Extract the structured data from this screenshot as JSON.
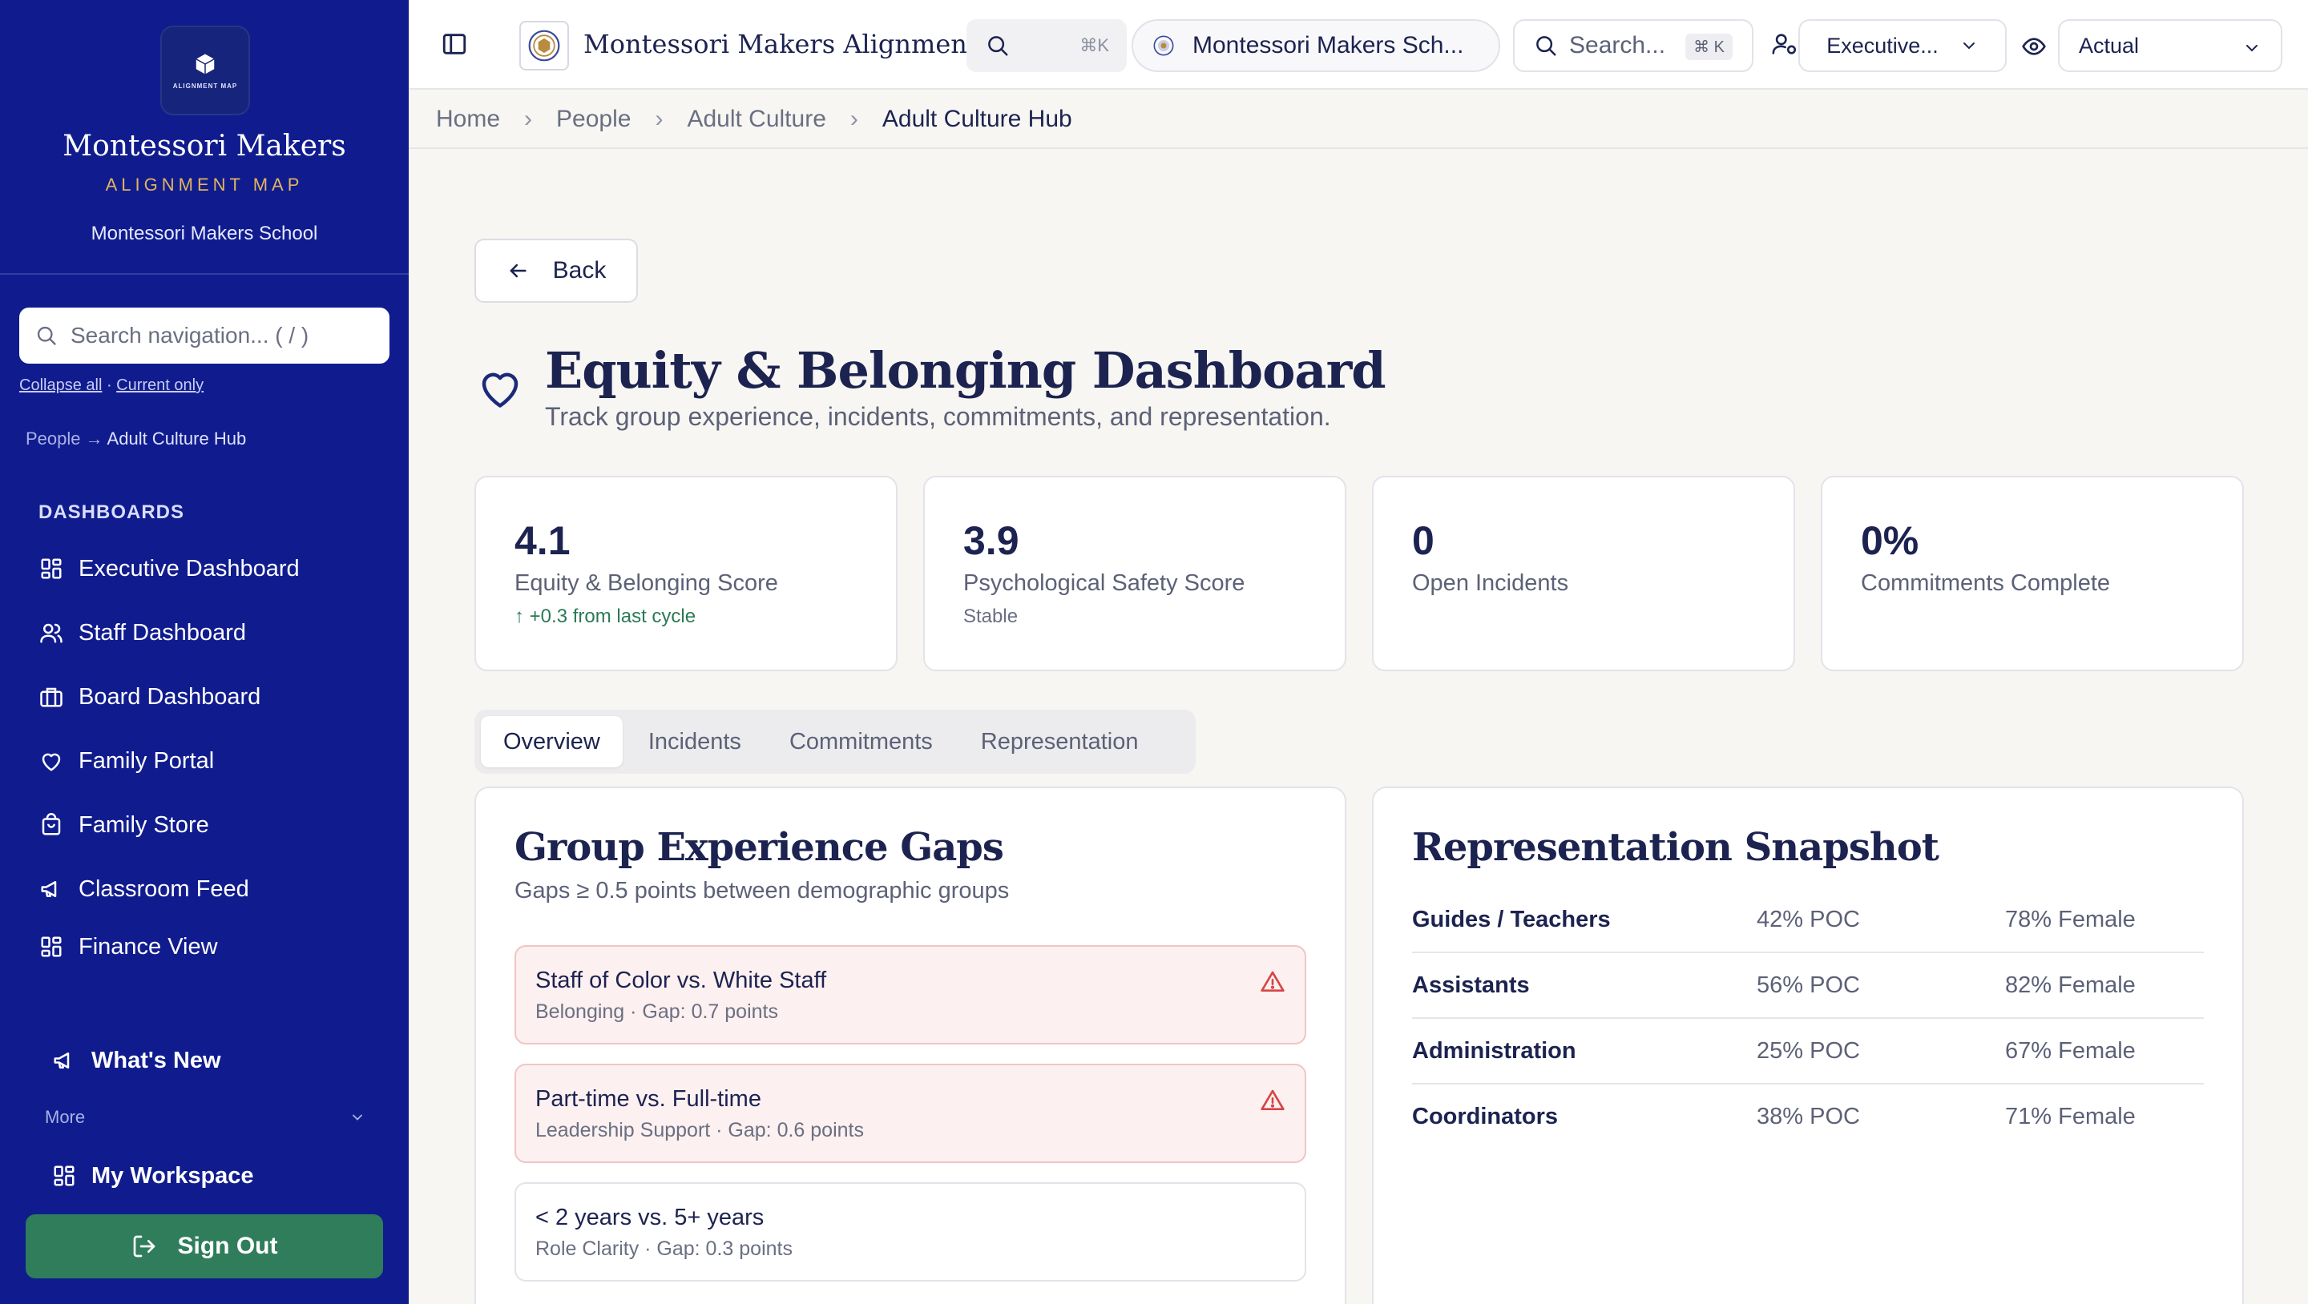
{
  "sidebar": {
    "logo_caption": "ALIGNMENT MAP",
    "brand_title": "Montessori Makers",
    "brand_subtitle": "ALIGNMENT MAP",
    "school": "Montessori Makers School",
    "search_placeholder": "Search navigation... ( / )",
    "collapse_all": "Collapse all",
    "current_only": "Current only",
    "crumb_parent": "People",
    "crumb_arrow": "→",
    "crumb_current": "Adult Culture Hub",
    "section_heading": "DASHBOARDS",
    "items": [
      {
        "label": "Executive Dashboard",
        "icon": "grid-icon"
      },
      {
        "label": "Staff Dashboard",
        "icon": "users-icon"
      },
      {
        "label": "Board Dashboard",
        "icon": "briefcase-icon"
      },
      {
        "label": "Family Portal",
        "icon": "heart-icon"
      },
      {
        "label": "Family Store",
        "icon": "shopping-bag-icon"
      },
      {
        "label": "Classroom Feed",
        "icon": "megaphone-icon"
      },
      {
        "label": "Finance View",
        "icon": "grid-icon"
      }
    ],
    "whats_new": "What's New",
    "more": "More",
    "my_workspace": "My Workspace",
    "sign_out": "Sign Out"
  },
  "topbar": {
    "app_title": "Montessori Makers Alignmen...",
    "kbar_shortcut": "⌘K",
    "school_selector": "Montessori Makers Sch...",
    "search_placeholder": "Search...",
    "search_shortcut": "⌘ K",
    "role_selector": "Executive...",
    "view_selector": "Actual"
  },
  "breadcrumb": [
    "Home",
    "People",
    "Adult Culture",
    "Adult Culture Hub"
  ],
  "breadcrumb_sep": "›",
  "main": {
    "back_label": "Back",
    "title": "Equity & Belonging Dashboard",
    "subtitle": "Track group experience, incidents, commitments, and representation.",
    "stats": [
      {
        "value": "4.1",
        "label": "Equity & Belonging Score",
        "note": "↑ +0.3 from last cycle"
      },
      {
        "value": "3.9",
        "label": "Psychological Safety Score",
        "note": "Stable"
      },
      {
        "value": "0",
        "label": "Open Incidents",
        "note": ""
      },
      {
        "value": "0%",
        "label": "Commitments Complete",
        "note": ""
      }
    ],
    "tabs": [
      "Overview",
      "Incidents",
      "Commitments",
      "Representation"
    ],
    "active_tab": "Overview",
    "gaps_card": {
      "title": "Group Experience Gaps",
      "subtitle": "Gaps ≥ 0.5 points between demographic groups",
      "items": [
        {
          "name": "Staff of Color vs. White Staff",
          "detail": "Belonging · Gap: 0.7 points",
          "alert": true
        },
        {
          "name": "Part-time vs. Full-time",
          "detail": "Leadership Support · Gap: 0.6 points",
          "alert": true
        },
        {
          "name": "< 2 years vs. 5+ years",
          "detail": "Role Clarity · Gap: 0.3 points",
          "alert": false
        }
      ]
    },
    "rep_card": {
      "title": "Representation Snapshot",
      "rows": [
        {
          "role": "Guides / Teachers",
          "poc": "42% POC",
          "female": "78% Female"
        },
        {
          "role": "Assistants",
          "poc": "56% POC",
          "female": "82% Female"
        },
        {
          "role": "Administration",
          "poc": "25% POC",
          "female": "67% Female"
        },
        {
          "role": "Coordinators",
          "poc": "38% POC",
          "female": "71% Female"
        }
      ]
    }
  },
  "colors": {
    "sidebar_bg": "#101c8e",
    "accent_gold": "#e2b45d",
    "signout_green": "#2f7d5b",
    "alert_red": "#d64545",
    "positive_green": "#2b7a55"
  }
}
